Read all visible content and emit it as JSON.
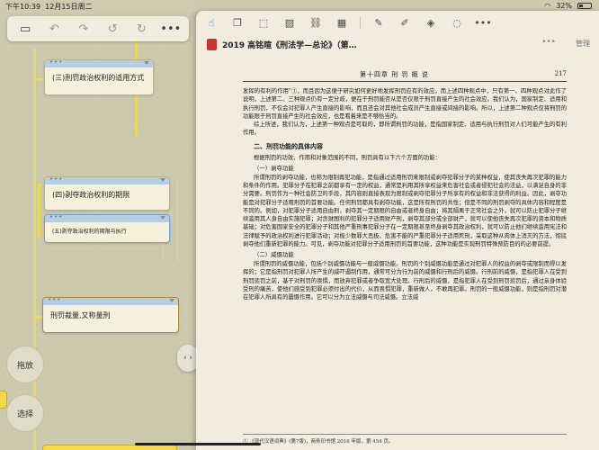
{
  "status_bar": {
    "time": "下午10:39",
    "date": "12月15日周二",
    "battery": "32%",
    "battery_level": 0.32
  },
  "mindmap": {
    "nodes": [
      {
        "text": "(三)刑罚政治权利的适用方式",
        "id": "n1"
      },
      {
        "text": "(四)剥夺政治权利的期限",
        "id": "n2"
      },
      {
        "text": "(五)剥夺政治权利的期限与执行",
        "id": "n3"
      },
      {
        "text": "刑罚裁量,又称量刑",
        "id": "n4"
      }
    ],
    "buttons": {
      "drag": "拖放",
      "select": "选择"
    },
    "toolbar_icons": [
      "undo-icon",
      "redo-icon",
      "undo-step-icon",
      "redo-step-icon",
      "more-icon"
    ]
  },
  "reader": {
    "title": "2019 高铭暄《刑法学—总论》（第…",
    "manage": "管理",
    "page_header_left": "",
    "page_header_chapter": "第十四章   刑 罚 概 说",
    "page_number": "217",
    "paragraphs": [
      "发挥的有利的作用\"①，而且因为这便于研究如何更好地发挥刑罚应有的效应。而上述四种观点中，只有第一、四种观点对此作了说明，上述第二、三种观点仍有一定分歧，便在于刑罚能否从是否仅限于刑罚直接产生的社会效应。我们认为，国家制定、适用和执行刑罚，不仅会对犯罪人产生直接的影响，而且还会对其他社会成员产生直接或间接的影响。所以，上述第二种观点仅将刑罚的功能限于刑罚直接产生的社会效应，也是看着来是不够恰当的。",
      "综上所述，我们认为，上述第一种观点是可取的，即所谓刑罚的功能，是指国家制定、适用与执行刑罚对人们可能产生的有利作用。"
    ],
    "section2": "二、刑罚功能的具体内容",
    "intro": "根据刑罚的功效、作用和对象范围的不同，刑罚具有以下六个方面的功能：",
    "sub1": "（一）剥夺功能",
    "body1": [
      "所谓刑罚的剥夺功能，也称为限制再犯功能，是指通过适用刑罚来限制或剥夺犯罪分子的某种权益，使其丧失再次犯罪的能力和条件的作用。犯罪分子在犯罪之前都享有一定的权益，通常是利用其所享权益来危害社会或者侵犯社会的法益，以满足自身的非分需要。刑罚作为一种社会防卫的手段，其内容则直接表现为限制或剥夺犯罪分子所享有的权益和非法获得的利益。因此，剥夺功能是对犯罪分子适用刑罚的首要功能。任何刑罚都具有剥夺功能，这是所有刑罚的共性；但是不同的刑罚剥夺的具体内容和程度是不同的。例如，对犯罪分子适用自由刑，剥夺其一定期限的自由或者终身自由；将其隔离于正常社会之外，就可以防止犯罪分子继续滥用其人身自由实施犯罪；对贪财图利的犯罪分子适用财产刑，剥夺其部分或全部财产，就可以使他丧失再次犯罪的资本和物质基础；对危害国家安全的犯罪分子和其他严重刑事犯罪分子在一定期限甚至终身剥夺其政治权利，就可以防止他们继续滥用宪法和法律赋予的政治权利进行犯罪活动；对极少数罪大恶极、危害不能的严重犯罪分子适用死刑，采取这种从肉体上消灭的方法，彻底剥夺他们重新犯罪的能力。可见，剥夺功能对犯罪分子适用刑罚的首要功能，这种功能是实现刑罚特殊预防目的的必要前提。"
    ],
    "sub2": "（二）威慑功能",
    "body2": [
      "所谓刑罚的威慑功能，包括个别威慑功能与一般威慑功能。刑罚的个别威慑功能是通过对犯罪人的权益的剥夺或限制而得以发挥的；它是指刑罚对犯罪人所产生的威吓遏制作用，通常可分为行为前的威慑和行刑后的威慑。行刑前的威慑，是指犯罪人在受到刑罚惩罚之前，基于对刑罚的畏惧，而放弃犯罪或者争取宽大处理。行刑后的威慑，是指犯罪人在受到刑罚惩罚后，通过亲身体验受刑的痛苦，使他们感受到犯罪必须付出的代价，从而畏惧犯罪，重新做人，不敢再犯罪。刑罚的一般威慑功能，则是指刑罚对潜在犯罪人所具有的震慑作用。它可以分为立法威慑与司法威慑。立法威"
    ],
    "footnote": "① 《现代汉语词典》(第7版)，商务印书馆 2016 年版，第 454 页。"
  }
}
